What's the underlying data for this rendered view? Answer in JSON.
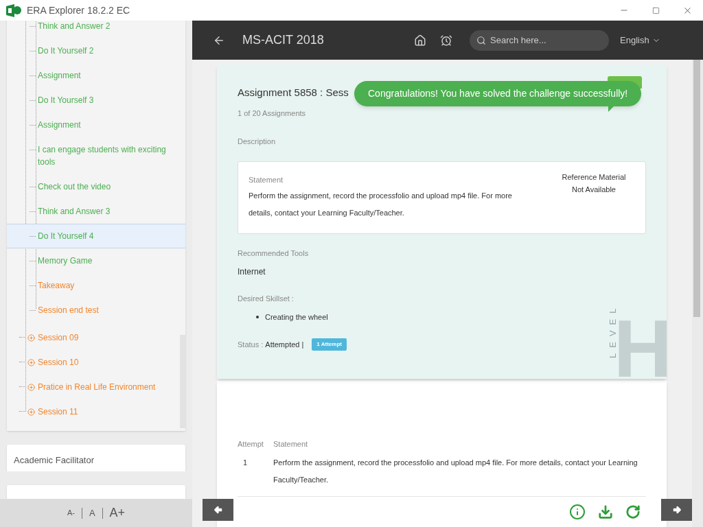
{
  "window": {
    "title": "ERA Explorer 18.2.2 EC"
  },
  "sidebar": {
    "tree_items": [
      {
        "label": "Think and Answer 2",
        "color": "#4caf50",
        "selected": false
      },
      {
        "label": "Do It Yourself 2",
        "color": "#4caf50",
        "selected": false
      },
      {
        "label": "Assignment",
        "color": "#4caf50",
        "selected": false
      },
      {
        "label": "Do It Yourself 3",
        "color": "#4caf50",
        "selected": false
      },
      {
        "label": "Assignment",
        "color": "#4caf50",
        "selected": false
      },
      {
        "label": "I can engage students with exciting tools",
        "color": "#4caf50",
        "selected": false
      },
      {
        "label": "Check out the video",
        "color": "#4caf50",
        "selected": false
      },
      {
        "label": "Think and Answer 3",
        "color": "#4caf50",
        "selected": false
      },
      {
        "label": "Do It Yourself 4",
        "color": "#4caf50",
        "selected": true
      },
      {
        "label": "Memory Game",
        "color": "#4caf50",
        "selected": false
      },
      {
        "label": "Takeaway",
        "color": "#f0862e",
        "selected": false
      },
      {
        "label": "Session end test",
        "color": "#f0862e",
        "selected": false
      }
    ],
    "sessions": [
      {
        "label": "Session 09",
        "expanded": false
      },
      {
        "label": "Session 10",
        "expanded": false
      },
      {
        "label": "Pratice in Real Life Environment",
        "expanded": false
      },
      {
        "label": "Session 11",
        "expanded": false
      }
    ],
    "cards": [
      "Academic Facilitator"
    ],
    "font_size_controls": [
      "A-",
      "A",
      "A+"
    ]
  },
  "topbar": {
    "title": "MS-ACIT 2018",
    "search": {
      "placeholder": "Search here..."
    },
    "language": "English"
  },
  "assignment": {
    "title": "Assignment 5858 : Sess",
    "subtitle": "1 of 20 Assignments",
    "description_label": "Description",
    "statement_label": "Statement",
    "statement": "Perform the assignment, record the processfolio and upload mp4 file. For more details, contact your Learning Faculty/Teacher.",
    "reference": [
      "Reference Material",
      "Not Available"
    ],
    "tools_label": "Recommended Tools",
    "tools": "Internet",
    "skillset_label": "Desired Skillset :",
    "skills": [
      "Creating the wheel"
    ],
    "status_label": "Status :",
    "status": "Attempted |",
    "attempts_badge": "1 Attempt",
    "level_label": "LEVEL",
    "level": "H"
  },
  "toast": "Congratulations! You have solved the challenge successfully!",
  "attempts": {
    "columns": [
      "Attempt",
      "Statement"
    ],
    "rows": [
      {
        "attempt": "1",
        "statement": "Perform the assignment, record the processfolio and upload mp4 file. For more details, contact your Learning Faculty/Teacher."
      }
    ]
  }
}
